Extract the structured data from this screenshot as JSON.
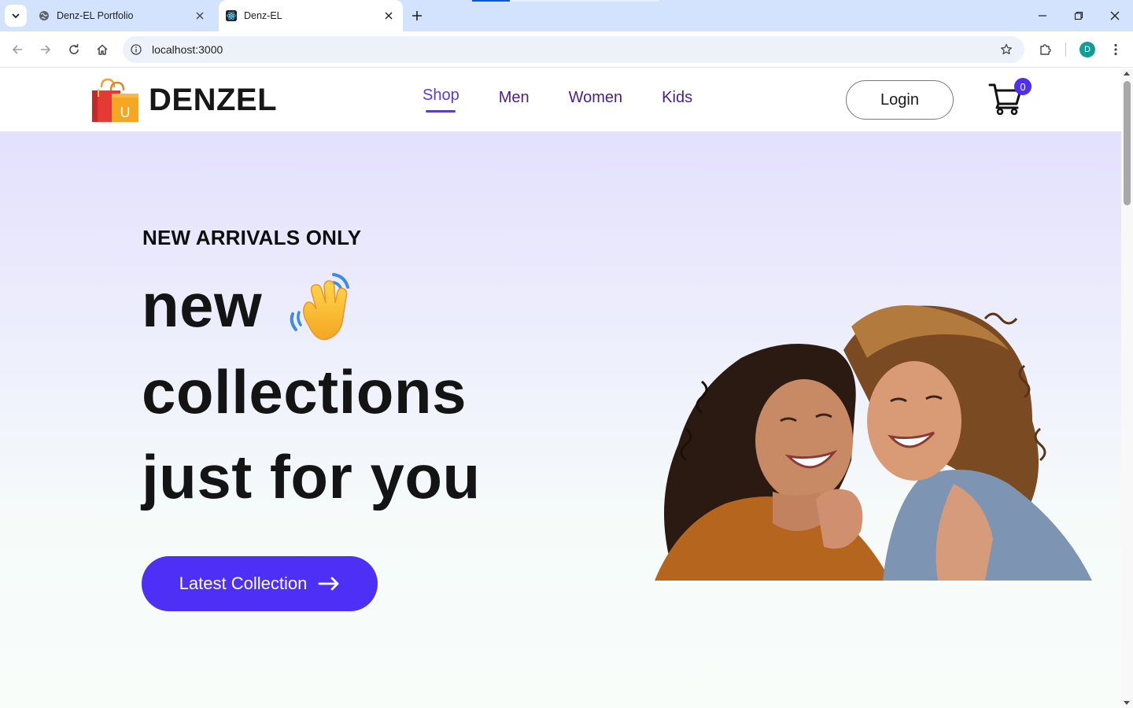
{
  "browser": {
    "tabs": [
      {
        "title": "Denz-EL Portfolio",
        "active": false,
        "favicon": "globe-icon"
      },
      {
        "title": "Denz-EL",
        "active": true,
        "favicon": "react-icon"
      }
    ],
    "url": "localhost:3000",
    "profile_initial": "D"
  },
  "navbar": {
    "brand": "DENZEL",
    "logo_letter": "U",
    "menu": [
      {
        "label": "Shop",
        "active": true
      },
      {
        "label": "Men",
        "active": false
      },
      {
        "label": "Women",
        "active": false
      },
      {
        "label": "Kids",
        "active": false
      }
    ],
    "login_label": "Login",
    "cart_count": "0"
  },
  "hero": {
    "kicker": "NEW ARRIVALS ONLY",
    "line1": "new",
    "line2": "collections",
    "line3": "just for you",
    "cta_label": "Latest Collection",
    "image": "two-laughing-women-photo"
  },
  "colors": {
    "accent": "#4d2ff5",
    "nav_text": "#4b1d8f",
    "hero_gradient_top": "#e4e0fd",
    "hero_gradient_bottom": "#f8fdfa"
  }
}
